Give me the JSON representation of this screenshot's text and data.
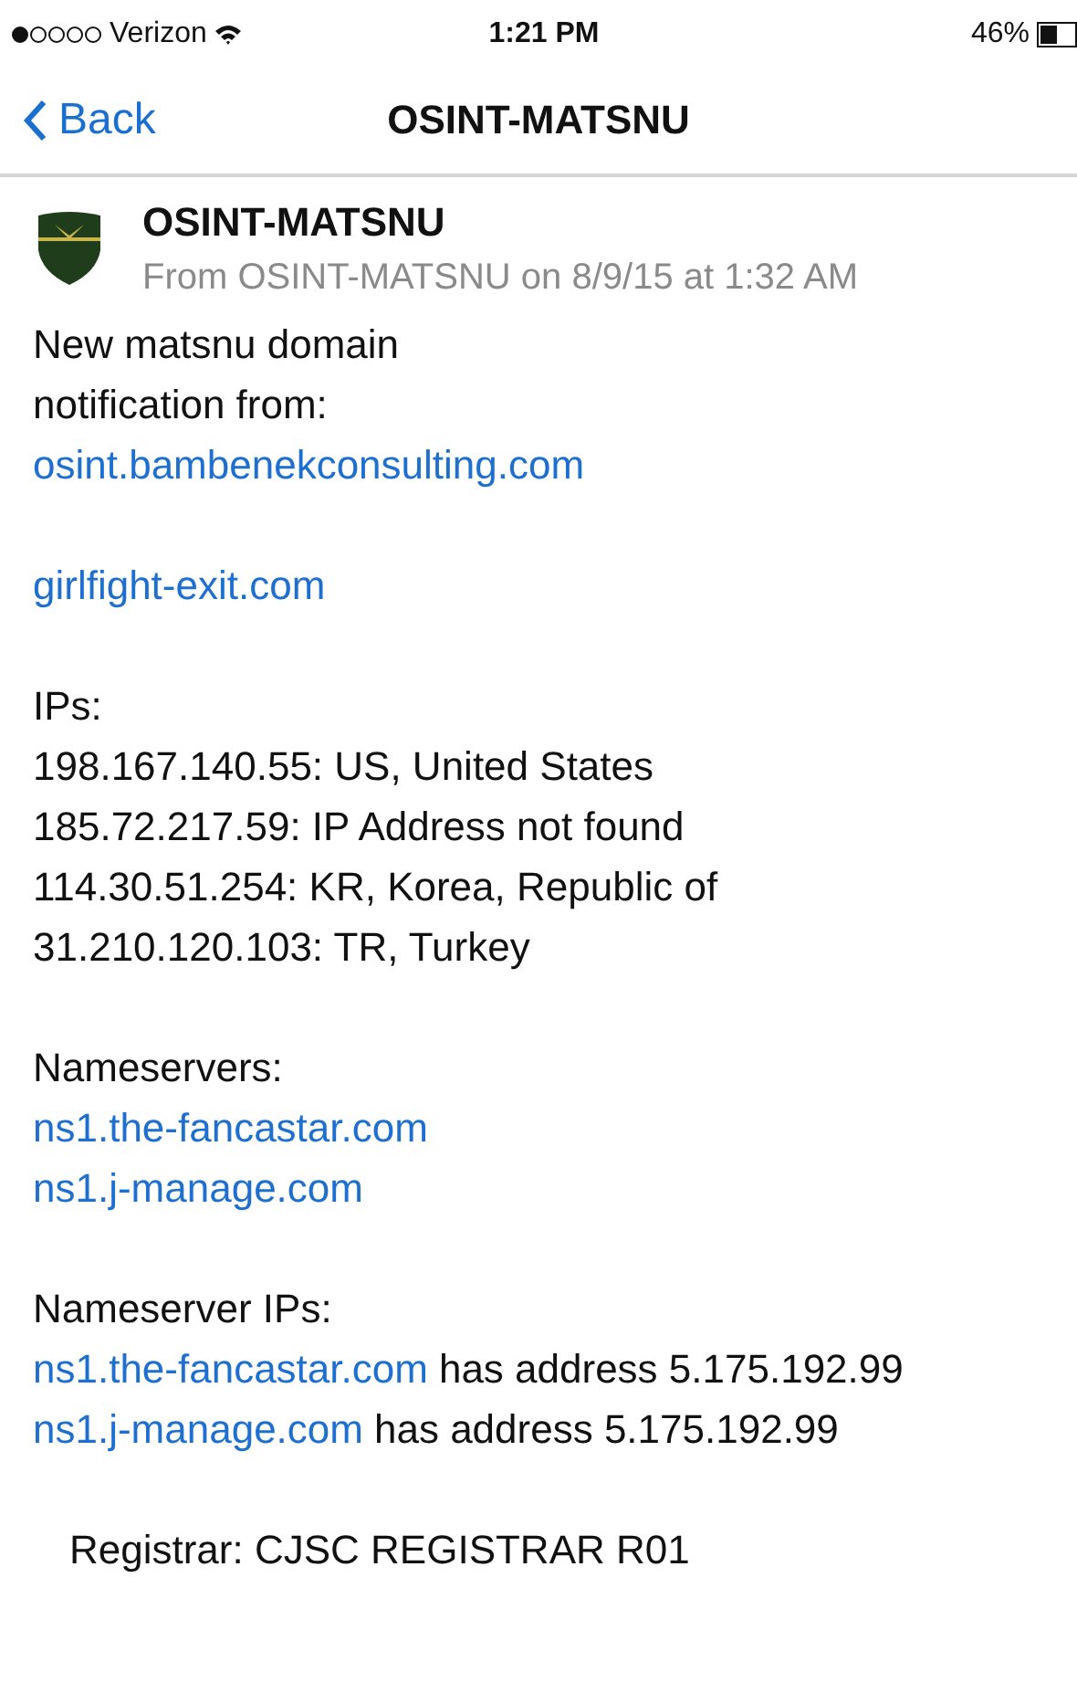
{
  "status_bar": {
    "carrier": "Verizon",
    "time": "1:21 PM",
    "battery": "46%"
  },
  "nav": {
    "back": "Back",
    "title": "OSINT-MATSNU"
  },
  "message": {
    "sender": "OSINT-MATSNU",
    "meta": "From OSINT-MATSNU on 8/9/15 at 1:32 AM"
  },
  "body": [
    {
      "kind": "text",
      "segments": [
        {
          "text": "New matsnu domain",
          "link": false
        }
      ]
    },
    {
      "kind": "text",
      "segments": [
        {
          "text": "notification from:",
          "link": false
        }
      ]
    },
    {
      "kind": "text",
      "segments": [
        {
          "text": "osint.bambenekconsulting.com",
          "link": true
        }
      ]
    },
    {
      "kind": "gap"
    },
    {
      "kind": "text",
      "segments": [
        {
          "text": "girlfight-exit.com",
          "link": true
        }
      ]
    },
    {
      "kind": "gap"
    },
    {
      "kind": "text",
      "segments": [
        {
          "text": "IPs:",
          "link": false
        }
      ]
    },
    {
      "kind": "text",
      "segments": [
        {
          "text": "198.167.140.55: US, United States",
          "link": false
        }
      ]
    },
    {
      "kind": "text",
      "segments": [
        {
          "text": "185.72.217.59: IP Address not found",
          "link": false
        }
      ]
    },
    {
      "kind": "text",
      "segments": [
        {
          "text": "114.30.51.254: KR, Korea, Republic of",
          "link": false
        }
      ]
    },
    {
      "kind": "text",
      "segments": [
        {
          "text": "31.210.120.103: TR, Turkey",
          "link": false
        }
      ]
    },
    {
      "kind": "gap"
    },
    {
      "kind": "text",
      "segments": [
        {
          "text": "Nameservers:",
          "link": false
        }
      ]
    },
    {
      "kind": "text",
      "segments": [
        {
          "text": "ns1.the-fancastar.com",
          "link": true
        }
      ]
    },
    {
      "kind": "text",
      "segments": [
        {
          "text": "ns1.j-manage.com",
          "link": true
        }
      ]
    },
    {
      "kind": "gap"
    },
    {
      "kind": "text",
      "segments": [
        {
          "text": "Nameserver IPs:",
          "link": false
        }
      ]
    },
    {
      "kind": "text",
      "segments": [
        {
          "text": "ns1.the-fancastar.com",
          "link": true
        },
        {
          "text": "has address 5.175.192.99",
          "link": false
        }
      ]
    },
    {
      "kind": "text",
      "segments": [
        {
          "text": "ns1.j-manage.com",
          "link": true
        },
        {
          "text": "has address 5.175.192.99",
          "link": false
        }
      ]
    },
    {
      "kind": "gap"
    },
    {
      "kind": "indented",
      "segments": [
        {
          "text": "Registrar: CJSC REGISTRAR R01",
          "link": false
        }
      ]
    }
  ]
}
